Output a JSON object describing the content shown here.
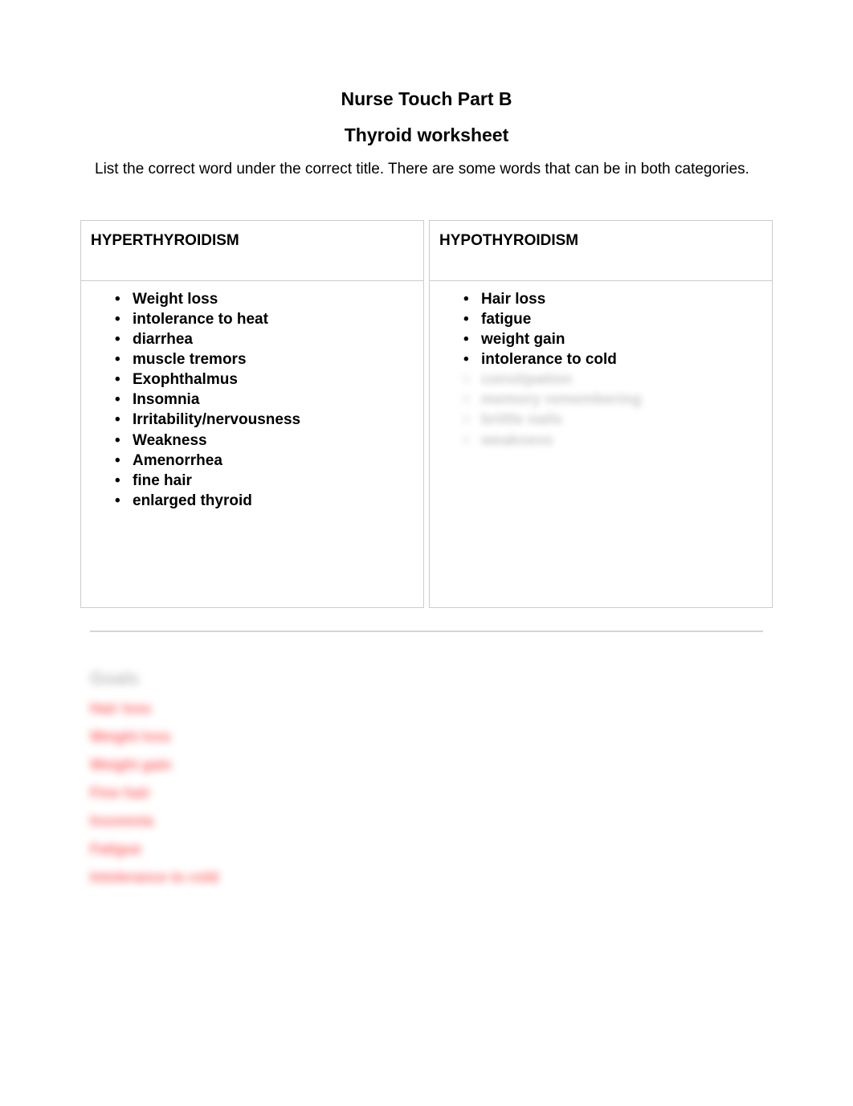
{
  "titles": {
    "main": "Nurse Touch Part B",
    "sub": "Thyroid worksheet"
  },
  "instructions": "List the correct word under the correct title.  There are some words that can be in both categories.",
  "columns": {
    "left": {
      "header": "HYPERTHYROIDISM",
      "items": [
        "Weight loss",
        " intolerance to heat",
        "diarrhea",
        "muscle tremors",
        "Exophthalmus",
        "Insomnia",
        "Irritability/nervousness",
        "Weakness",
        "Amenorrhea",
        "fine hair",
        "enlarged thyroid"
      ]
    },
    "right": {
      "header": "HYPOTHYROIDISM",
      "items": [
        "Hair loss",
        "fatigue",
        "weight gain",
        " intolerance to cold"
      ],
      "blurred_items": [
        "constipation",
        "memory remembering",
        "brittle nails",
        "weakness"
      ]
    }
  },
  "goals": {
    "header": "Goals",
    "items": [
      "Hair loss",
      "Weight loss",
      "Weight gain",
      "Fine hair",
      "Insomnia",
      "Fatigue",
      "Intolerance to cold"
    ]
  }
}
